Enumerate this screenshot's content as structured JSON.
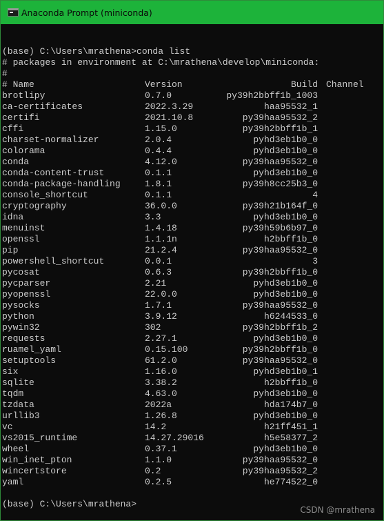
{
  "window": {
    "title": "Anaconda Prompt (miniconda)",
    "icon": "terminal-icon"
  },
  "console": {
    "prompt_command": "(base) C:\\Users\\mrathena>conda list",
    "env_line": "# packages in environment at C:\\mrathena\\develop\\miniconda:",
    "hash_line": "#",
    "headers": {
      "name": "# Name",
      "version": "Version",
      "build": "Build",
      "channel": "Channel"
    },
    "packages": [
      {
        "name": "brotlipy",
        "version": "0.7.0",
        "build": "py39h2bbff1b_1003"
      },
      {
        "name": "ca-certificates",
        "version": "2022.3.29",
        "build": "haa95532_1"
      },
      {
        "name": "certifi",
        "version": "2021.10.8",
        "build": "py39haa95532_2"
      },
      {
        "name": "cffi",
        "version": "1.15.0",
        "build": "py39h2bbff1b_1"
      },
      {
        "name": "charset-normalizer",
        "version": "2.0.4",
        "build": "pyhd3eb1b0_0"
      },
      {
        "name": "colorama",
        "version": "0.4.4",
        "build": "pyhd3eb1b0_0"
      },
      {
        "name": "conda",
        "version": "4.12.0",
        "build": "py39haa95532_0"
      },
      {
        "name": "conda-content-trust",
        "version": "0.1.1",
        "build": "pyhd3eb1b0_0"
      },
      {
        "name": "conda-package-handling",
        "version": "1.8.1",
        "build": "py39h8cc25b3_0"
      },
      {
        "name": "console_shortcut",
        "version": "0.1.1",
        "build": "4"
      },
      {
        "name": "cryptography",
        "version": "36.0.0",
        "build": "py39h21b164f_0"
      },
      {
        "name": "idna",
        "version": "3.3",
        "build": "pyhd3eb1b0_0"
      },
      {
        "name": "menuinst",
        "version": "1.4.18",
        "build": "py39h59b6b97_0"
      },
      {
        "name": "openssl",
        "version": "1.1.1n",
        "build": "h2bbff1b_0"
      },
      {
        "name": "pip",
        "version": "21.2.4",
        "build": "py39haa95532_0"
      },
      {
        "name": "powershell_shortcut",
        "version": "0.0.1",
        "build": "3"
      },
      {
        "name": "pycosat",
        "version": "0.6.3",
        "build": "py39h2bbff1b_0"
      },
      {
        "name": "pycparser",
        "version": "2.21",
        "build": "pyhd3eb1b0_0"
      },
      {
        "name": "pyopenssl",
        "version": "22.0.0",
        "build": "pyhd3eb1b0_0"
      },
      {
        "name": "pysocks",
        "version": "1.7.1",
        "build": "py39haa95532_0"
      },
      {
        "name": "python",
        "version": "3.9.12",
        "build": "h6244533_0"
      },
      {
        "name": "pywin32",
        "version": "302",
        "build": "py39h2bbff1b_2"
      },
      {
        "name": "requests",
        "version": "2.27.1",
        "build": "pyhd3eb1b0_0"
      },
      {
        "name": "ruamel_yaml",
        "version": "0.15.100",
        "build": "py39h2bbff1b_0"
      },
      {
        "name": "setuptools",
        "version": "61.2.0",
        "build": "py39haa95532_0"
      },
      {
        "name": "six",
        "version": "1.16.0",
        "build": "pyhd3eb1b0_1"
      },
      {
        "name": "sqlite",
        "version": "3.38.2",
        "build": "h2bbff1b_0"
      },
      {
        "name": "tqdm",
        "version": "4.63.0",
        "build": "pyhd3eb1b0_0"
      },
      {
        "name": "tzdata",
        "version": "2022a",
        "build": "hda174b7_0"
      },
      {
        "name": "urllib3",
        "version": "1.26.8",
        "build": "pyhd3eb1b0_0"
      },
      {
        "name": "vc",
        "version": "14.2",
        "build": "h21ff451_1"
      },
      {
        "name": "vs2015_runtime",
        "version": "14.27.29016",
        "build": "h5e58377_2"
      },
      {
        "name": "wheel",
        "version": "0.37.1",
        "build": "pyhd3eb1b0_0"
      },
      {
        "name": "win_inet_pton",
        "version": "1.1.0",
        "build": "py39haa95532_0"
      },
      {
        "name": "wincertstore",
        "version": "0.2",
        "build": "py39haa95532_2"
      },
      {
        "name": "yaml",
        "version": "0.2.5",
        "build": "he774522_0"
      }
    ],
    "final_prompt": "(base) C:\\Users\\mrathena>"
  },
  "watermark": "CSDN @mrathena"
}
